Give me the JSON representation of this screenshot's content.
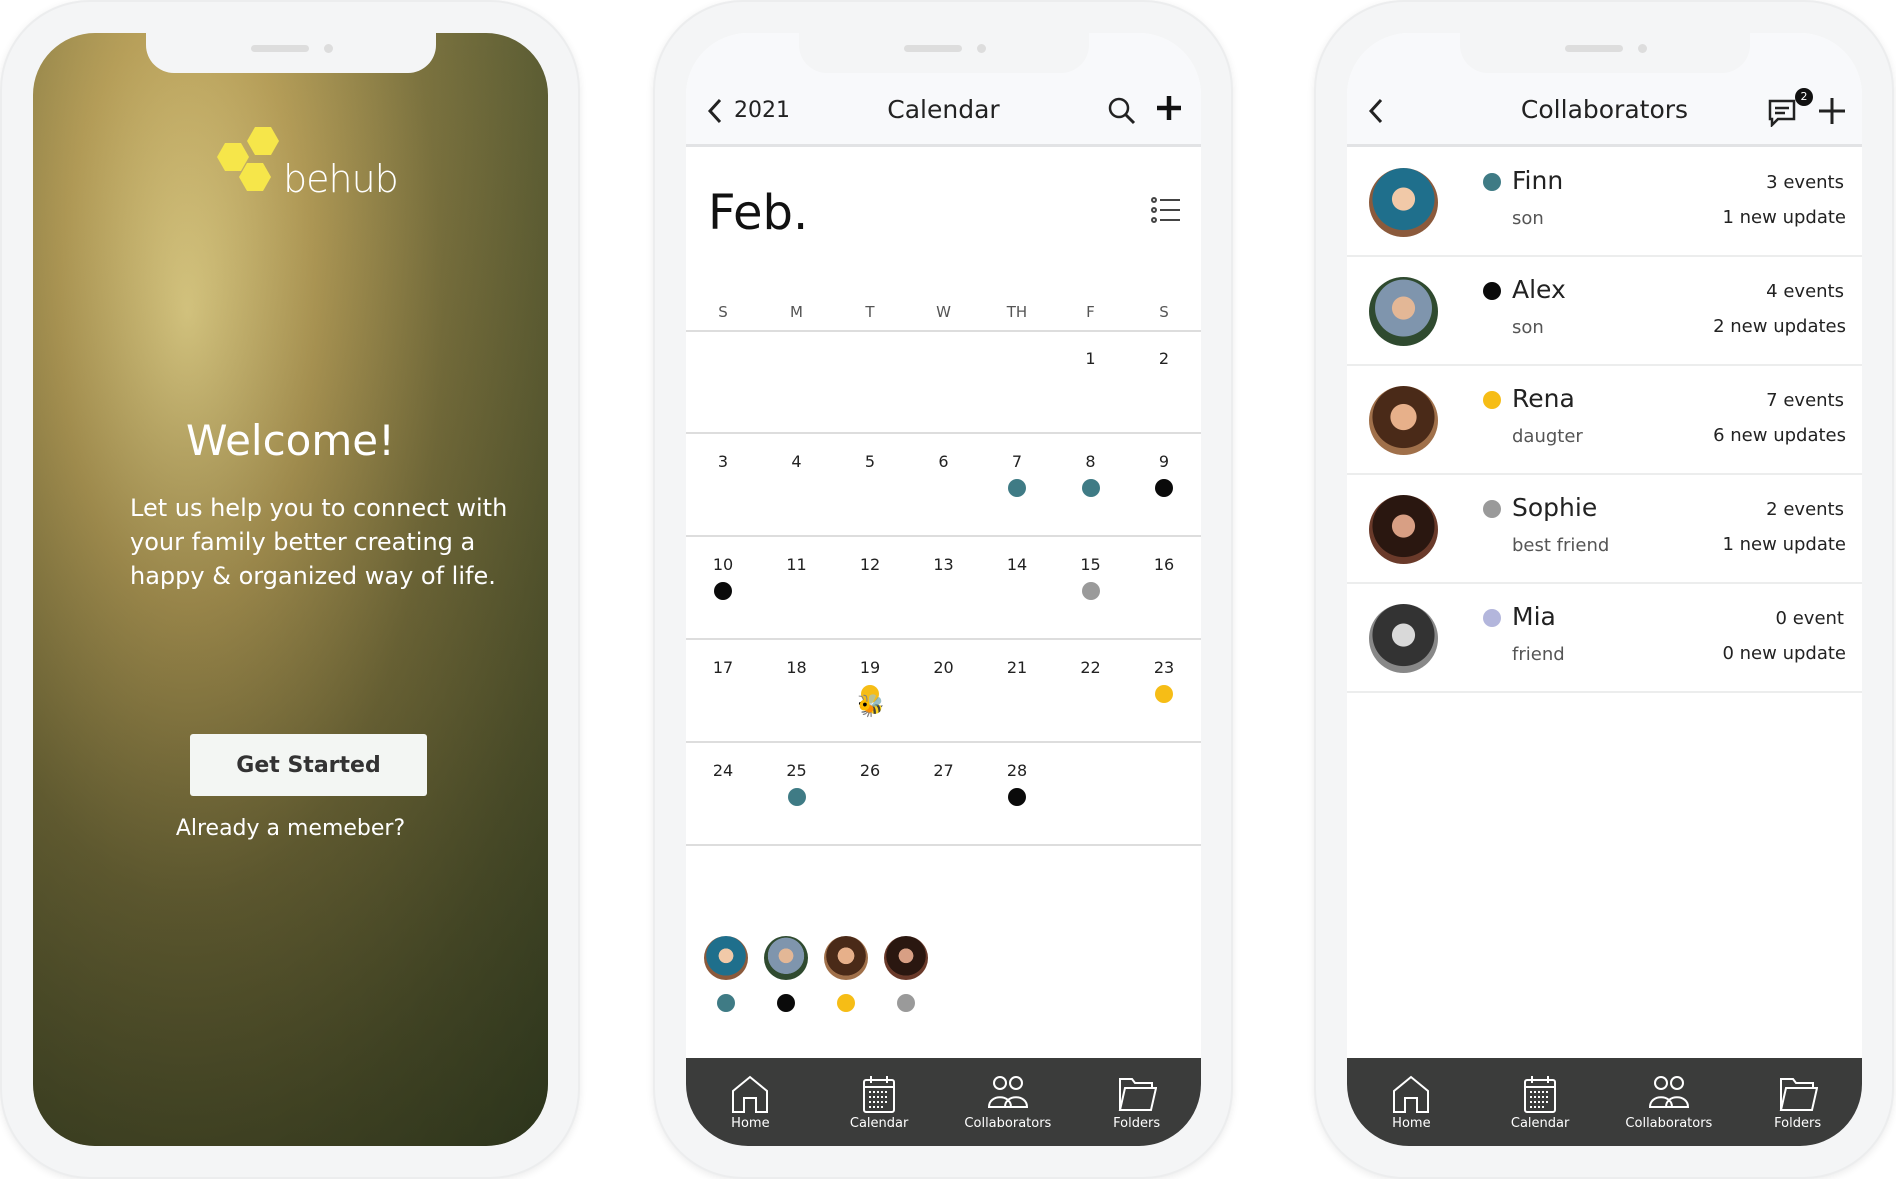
{
  "welcome": {
    "logo_text": "behub",
    "title": "Welcome!",
    "paragraph": "Let us help you to connect with your family better creating a happy & organized way of life.",
    "get_started": "Get Started",
    "already_member": "Already a memeber?"
  },
  "calendar": {
    "year": "2021",
    "title": "Calendar",
    "month": "Feb.",
    "weekdays": [
      "S",
      "M",
      "T",
      "W",
      "TH",
      "F",
      "S"
    ],
    "weeks": [
      [
        null,
        null,
        null,
        null,
        null,
        "1",
        "2"
      ],
      [
        "3",
        "4",
        "5",
        "6",
        "7",
        "8",
        "9"
      ],
      [
        "10",
        "11",
        "12",
        "13",
        "14",
        "15",
        "16"
      ],
      [
        "17",
        "18",
        "19",
        "20",
        "21",
        "22",
        "23"
      ],
      [
        "24",
        "25",
        "26",
        "27",
        "28",
        null,
        null
      ]
    ],
    "events": {
      "7": "teal",
      "8": "teal",
      "9": "black",
      "10": "black",
      "15": "gray",
      "19": "yellow",
      "23": "yellow",
      "25": "teal",
      "28": "black"
    },
    "bee_day": "19",
    "legend": [
      "teal",
      "black",
      "yellow",
      "gray"
    ]
  },
  "colors": {
    "teal": "#3f7b85",
    "black": "#0a0a0a",
    "yellow": "#f6bd16",
    "gray": "#9a9a9a",
    "lavender": "#b3b6dc"
  },
  "collaborators": {
    "title": "Collaborators",
    "message_badge": "2",
    "items": [
      {
        "name": "Finn",
        "relation": "son",
        "events": "3 events",
        "updates": "1 new update",
        "color": "teal"
      },
      {
        "name": "Alex",
        "relation": "son",
        "events": "4 events",
        "updates": "2 new updates",
        "color": "black"
      },
      {
        "name": "Rena",
        "relation": "daugter",
        "events": "7 events",
        "updates": "6 new updates",
        "color": "yellow"
      },
      {
        "name": "Sophie",
        "relation": "best friend",
        "events": "2 events",
        "updates": "1 new update",
        "color": "gray"
      },
      {
        "name": "Mia",
        "relation": "friend",
        "events": "0 event",
        "updates": "0 new update",
        "color": "lavender"
      }
    ]
  },
  "tabbar": {
    "items": [
      "Home",
      "Calendar",
      "Collaborators",
      "Folders"
    ]
  }
}
